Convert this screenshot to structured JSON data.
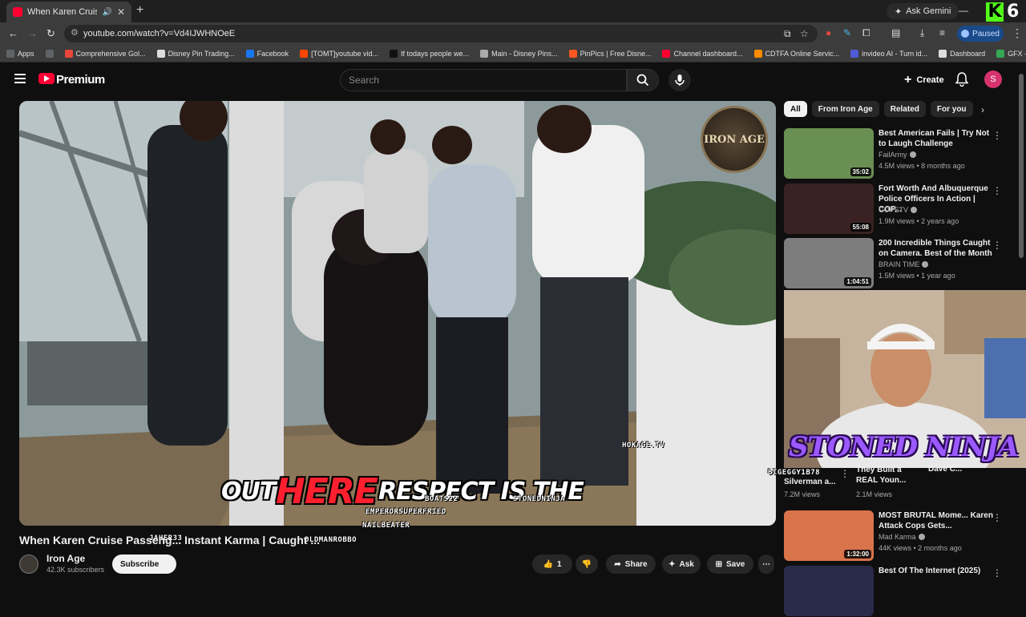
{
  "browser": {
    "tab_title": "When Karen Cruise Passeng",
    "tab_close": "✕",
    "new_tab": "+",
    "ask_gemini": "Ask Gemini",
    "kick_letter": "K",
    "kick_count": "6",
    "url": "youtube.com/watch?v=Vd4IJWHNOeE",
    "paused_label": "Paused",
    "bookmarks": [
      {
        "label": "Apps",
        "color": "#5f6368"
      },
      {
        "label": "",
        "color": "#5f6368"
      },
      {
        "label": "Comprehensive Gol...",
        "color": "#e8453c"
      },
      {
        "label": "Disney Pin Trading...",
        "color": "#dddddd"
      },
      {
        "label": "Facebook",
        "color": "#1877f2"
      },
      {
        "label": "[TOMT]youtube vid...",
        "color": "#ff4500"
      },
      {
        "label": "If todays people we...",
        "color": "#111111"
      },
      {
        "label": "Main - Disney Pins...",
        "color": "#aaaaaa"
      },
      {
        "label": "PinPics | Free Disne...",
        "color": "#ff5722"
      },
      {
        "label": "Channel dashboard...",
        "color": "#ff0033"
      },
      {
        "label": "CDTFA Online Servic...",
        "color": "#ff8c00"
      },
      {
        "label": "invideo AI - Turn id...",
        "color": "#4f5bd5"
      },
      {
        "label": "Dashboard",
        "color": "#dddddd"
      },
      {
        "label": "GFX - Google Drive",
        "color": "#34a853"
      }
    ]
  },
  "youtube": {
    "brand": "Premium",
    "search_placeholder": "Search",
    "create_label": "Create",
    "avatar_letter": "S"
  },
  "video": {
    "watermark": "IRON AGE",
    "subtitle_words": [
      "OUT",
      "HERE",
      "RESPECT IS THE"
    ],
    "overlay_handles": [
      "HOKAGE.TV",
      "BIGEGGY1B78",
      "BOATS22",
      "STONEDNINJA",
      "EMPERORSUPERFRIED",
      "NAILBEATER",
      "JAHER33",
      "OLDMANROBBO"
    ],
    "title": "When Karen Cruise Passeng... Instant Karma | Caught ...",
    "channel": "Iron Age",
    "subscribers": "42.3K subscribers",
    "subscribe_label": "Subscribe",
    "share_label": "Share",
    "ask_label": "Ask",
    "save_label": "Save",
    "like_count": "1"
  },
  "sidebar": {
    "chips": [
      "All",
      "From Iron Age",
      "Related",
      "For you"
    ],
    "recs": [
      {
        "title": "Best American Fails | Try Not to Laugh Challenge",
        "channel": "FailArmy",
        "meta": "4.5M views • 8 months ago",
        "duration": "35:02",
        "color": "#6a8f52"
      },
      {
        "title": "Fort Worth And Albuquerque Police Officers In Action | COP...",
        "channel": "COPSTV",
        "meta": "1.9M views • 2 years ago",
        "duration": "55:08",
        "color": "#3a2222"
      },
      {
        "title": "200 Incredible Things Caught on Camera. Best of the Month",
        "channel": "BRAIN TIME",
        "meta": "1.5M views • 1 year ago",
        "duration": "1:04:51",
        "color": "#7d7d7d"
      }
    ],
    "partial_recs": [
      {
        "title": "They Built a REAL Youn...",
        "meta": "2.1M views"
      },
      {
        "title": "Dave C..."
      }
    ],
    "partial_left": {
      "title": "Silverman a...",
      "meta": "7.2M views"
    },
    "lower_recs": [
      {
        "title": "MOST BRUTAL Mome... Karen Attack Cops Gets...",
        "channel": "Mad Karma",
        "meta": "44K views • 2 months ago",
        "duration": "1:32:00",
        "color": "#d9734a"
      },
      {
        "title": "Best Of The Internet (2025)",
        "color": "#2a2a4a"
      }
    ],
    "cam_banner": "STONED NINJA"
  }
}
